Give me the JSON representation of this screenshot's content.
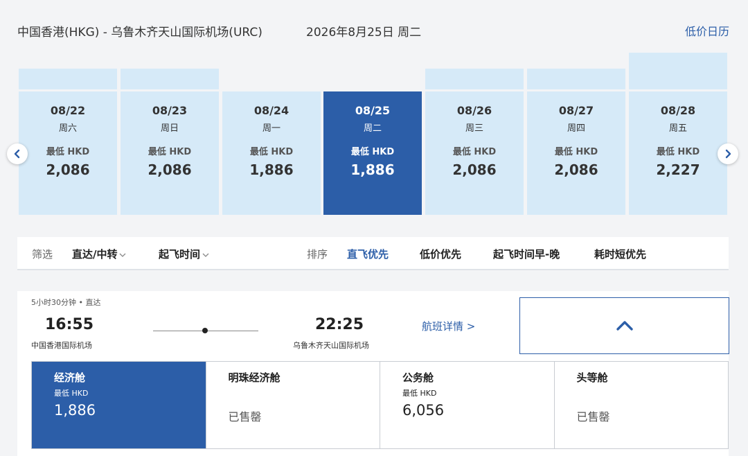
{
  "header": {
    "route": "中国香港(HKG) - 乌鲁木齐天山国际机场(URC)",
    "date": "2026年8月25日 周二",
    "calendar_link": "低价日历"
  },
  "price_label": "最低 HKD",
  "days": [
    {
      "date": "08/22",
      "weekday": "周六",
      "price": "2,086",
      "price_value": 2086
    },
    {
      "date": "08/23",
      "weekday": "周日",
      "price": "2,086",
      "price_value": 2086
    },
    {
      "date": "08/24",
      "weekday": "周一",
      "price": "1,886",
      "price_value": 1886
    },
    {
      "date": "08/25",
      "weekday": "周二",
      "price": "1,886",
      "price_value": 1886,
      "selected": true
    },
    {
      "date": "08/26",
      "weekday": "周三",
      "price": "2,086",
      "price_value": 2086
    },
    {
      "date": "08/27",
      "weekday": "周四",
      "price": "2,086",
      "price_value": 2086
    },
    {
      "date": "08/28",
      "weekday": "周五",
      "price": "2,227",
      "price_value": 2227
    }
  ],
  "filter": {
    "filter_label": "筛选",
    "direct_transfer": "直达/中转",
    "departure_time": "起飞时间",
    "sort_label": "排序",
    "sort_options": [
      "直飞优先",
      "低价优先",
      "起飞时间早-晚",
      "耗时短优先"
    ],
    "active_sort": "直飞优先"
  },
  "flight": {
    "duration_info": "5小时30分钟 • 直达",
    "dep_time": "16:55",
    "dep_airport": "中国香港国际机场",
    "arr_time": "22:25",
    "arr_airport": "乌鲁木齐天山国际机场",
    "details_link": "航班详情 >"
  },
  "cabins": [
    {
      "name": "经济舱",
      "label": "最低 HKD",
      "price": "1,886",
      "selected": true
    },
    {
      "name": "明珠经济舱",
      "status": "已售罄"
    },
    {
      "name": "公务舱",
      "label": "最低 HKD",
      "price": "6,056"
    },
    {
      "name": "头等舱",
      "status": "已售罄"
    }
  ],
  "colors": {
    "accent": "#2c5ea8",
    "card_bg": "#d6eaf8",
    "page_bg": "#f3f4f6"
  }
}
